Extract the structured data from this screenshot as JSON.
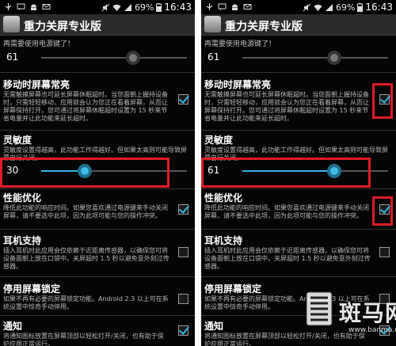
{
  "app": {
    "title": "重力关屏专业版"
  },
  "status": {
    "battery": "69%",
    "time": "16:43"
  },
  "top_note": "再需要使用电源键了！",
  "top_slider": {
    "value": "61",
    "level": 0.63
  },
  "screen_on": {
    "title": "移动时屏幕常亮",
    "desc": "无需触摸屏幕也可延长屏幕休眠超时。当您面朝上握持设备时，只需轻轻移动，应用就会认为您正在看着屏幕，从而让屏幕保持打开。您可通过将屏幕休眠超时设置为 15 秒来节省电量并让此功能来延长超时。",
    "checked": true
  },
  "sensitivity": {
    "title": "灵敏度",
    "desc": "灵敏度设置得越高，此功能工作得越好。但如果太高则可能导致屏幕自行关闭。",
    "left": {
      "value": "30",
      "level": 0.3
    },
    "right": {
      "value": "61",
      "level": 0.63
    }
  },
  "perf": {
    "title": "性能优化",
    "desc": "降低此功能的响应时间。如果您喜欢通过电源键来手动关闭屏幕，请不要选中此项，因为此项可能与您的操作冲突。",
    "checked": true
  },
  "headset": {
    "title": "耳机支持",
    "desc": "插入耳机时此应用会仅依赖于近距离传感器，以确保您可将设备面朝上放在口袋中。关屏超时 1.5 秒以避免意外刻过传感器。",
    "checked": false
  },
  "lock": {
    "title": "停用屏幕锁定",
    "desc": "如果不再有必要的屏幕锁定功能。Android 2.3 以上可在系统设置中惊奇手动停用。",
    "checked": false
  },
  "notify": {
    "title": "通知",
    "desc": "将通知图标放置在屏幕顶部以轻松打开/关闭，也有助于保护应用正常运行。",
    "checked": true
  },
  "watermark": {
    "text": "斑马网",
    "url": "www.banma.com"
  },
  "colors": {
    "accent": "#33b5e5",
    "highlight": "#e01b24"
  }
}
